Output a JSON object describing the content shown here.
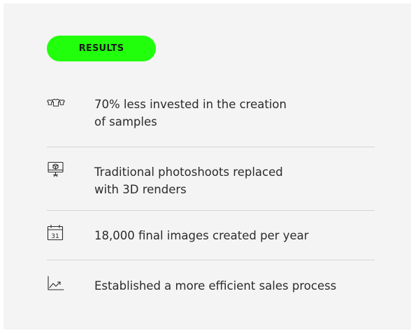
{
  "badge": {
    "label": "RESULTS"
  },
  "results": [
    {
      "icon": "tshirts-icon",
      "text": "70% less invested in the creation\nof samples"
    },
    {
      "icon": "monitor-3d-cube-icon",
      "text": "Traditional photoshoots replaced\nwith 3D renders"
    },
    {
      "icon": "calendar-icon",
      "calendar_day": "31",
      "text": "18,000 final images created per year"
    },
    {
      "icon": "trending-chart-icon",
      "text": "Established a more efficient sales process"
    }
  ],
  "colors": {
    "accent": "#22ff0d",
    "background": "#f4f4f4",
    "divider": "#d4d4d4",
    "text": "#2b2b2b"
  }
}
